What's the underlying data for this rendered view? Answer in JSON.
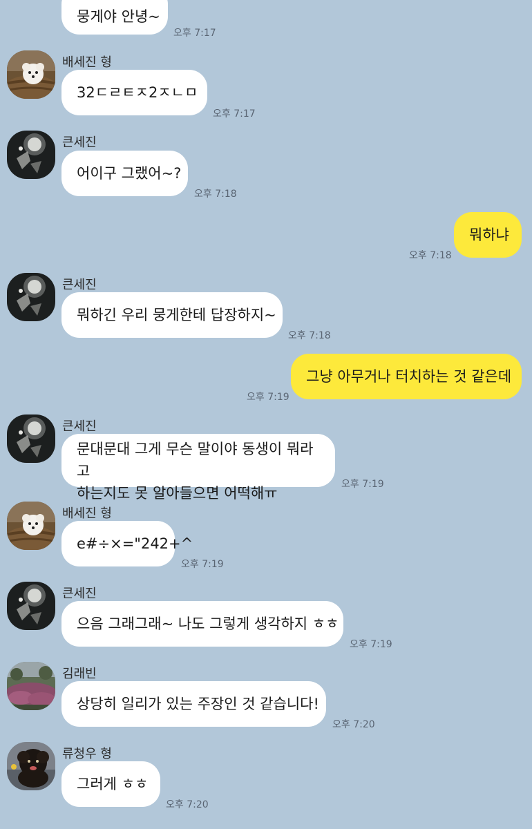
{
  "contacts": {
    "baesejin": "배세진 형",
    "keunsejin": "큰세진",
    "kimraebin": "김래빈",
    "ryucheongwoo": "류청우 형"
  },
  "messages": [
    {
      "sender": "",
      "text": "뭉게야 안녕~",
      "time": "오후 7:17"
    },
    {
      "sender": "배세진 형",
      "text": "32ㄷㄹㅌㅈ2ㅈㄴㅁ",
      "time": "오후 7:17"
    },
    {
      "sender": "큰세진",
      "text": "어이구 그랬어~?",
      "time": "오후 7:18"
    },
    {
      "sender": "me",
      "text": "뭐하냐",
      "time": "오후 7:18"
    },
    {
      "sender": "큰세진",
      "text": "뭐하긴 우리 뭉게한테 답장하지~",
      "time": "오후 7:18"
    },
    {
      "sender": "me",
      "text": "그냥 아무거나 터치하는 것 같은데",
      "time": "오후 7:19"
    },
    {
      "sender": "큰세진",
      "text_line1": "문대문대 그게 무슨 말이야 동생이 뭐라고",
      "text_line2": "하는지도 못 알아들으면 어떡해ㅠ",
      "time": "오후 7:19"
    },
    {
      "sender": "배세진 형",
      "text": "e#÷×=\"242+^",
      "time": "오후 7:19"
    },
    {
      "sender": "큰세진",
      "text": "으음 그래그래~ 나도 그렇게 생각하지 ㅎㅎ",
      "time": "오후 7:19"
    },
    {
      "sender": "김래빈",
      "text": "상당히 일리가 있는 주장인 것 같습니다!",
      "time": "오후 7:20"
    },
    {
      "sender": "류청우 형",
      "text": "그러게 ㅎㅎ",
      "time": "오후 7:20"
    }
  ],
  "colors": {
    "background": "#b2c7d9",
    "incoming_bubble": "#ffffff",
    "outgoing_bubble": "#fde93b"
  }
}
